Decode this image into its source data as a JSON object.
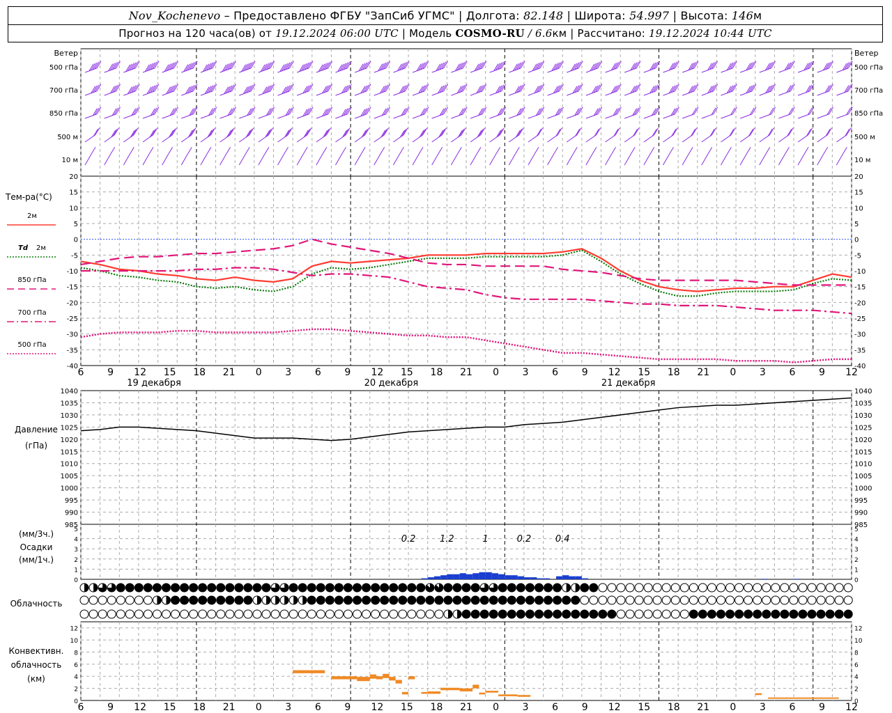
{
  "header": {
    "station": "Nov_Kochenevo",
    "provider": "– Предоставлено ФГБУ \"ЗапСиб УГМС\"",
    "lon_label": "Долгота:",
    "lon_value": "82.148",
    "lat_label": "Широта:",
    "lat_value": "54.997",
    "alt_label": "Высота:",
    "alt_value": "146",
    "alt_unit": "м",
    "forecast_prefix": "Прогноз на 120 часа(ов) от",
    "forecast_start": "19.12.2024 06:00 UTC",
    "model_label": "Модель",
    "model_name": "COSMO-RU",
    "model_res": "/ 6.6",
    "model_res_unit": "км",
    "calc_label": "Рассчитано:",
    "calc_time": "19.12.2024 10:44 UTC"
  },
  "time_axis": {
    "hour_ticks": [
      "6",
      "9",
      "12",
      "15",
      "18",
      "21",
      "0",
      "3",
      "6",
      "9",
      "12",
      "15",
      "18",
      "21",
      "0",
      "3",
      "6",
      "9",
      "12",
      "15",
      "18",
      "21",
      "0",
      "3",
      "6",
      "9",
      "12"
    ],
    "day_labels": [
      "19 декабря",
      "20 декабря",
      "21 декабря"
    ]
  },
  "wind_panel": {
    "title": "Ветер",
    "levels": [
      "500 гПа",
      "700 гПа",
      "850 гПа",
      "500 м",
      "10 м"
    ],
    "color": "#8a2be2"
  },
  "temp_panel": {
    "title": "Тем-ра(°C)",
    "legend": [
      {
        "label": "2м",
        "color": "#ff3b30",
        "style": "solid"
      },
      {
        "label_italic": "Td",
        "label": "2м",
        "color": "#0a7a0a",
        "style": "dotted"
      },
      {
        "label": "850 гПа",
        "color": "#e0157a",
        "style": "dash"
      },
      {
        "label": "700 гПа",
        "color": "#e0157a",
        "style": "dashdot"
      },
      {
        "label": "500 гПа",
        "color": "#e0157a",
        "style": "dotted"
      }
    ],
    "y_ticks": [
      "20",
      "15",
      "10",
      "5",
      "0",
      "-5",
      "-10",
      "-15",
      "-20",
      "-25",
      "-30",
      "-35",
      "-40"
    ]
  },
  "pressure_panel": {
    "title": "Давление",
    "unit": "(гПа)",
    "y_ticks": [
      "1040",
      "1035",
      "1030",
      "1025",
      "1020",
      "1015",
      "1010",
      "1005",
      "1000",
      "995",
      "990",
      "985"
    ]
  },
  "precip_panel": {
    "unit3": "(мм/3ч.)",
    "title": "Осадки",
    "unit1": "(мм/1ч.)",
    "y_ticks": [
      "5",
      "4",
      "3",
      "2",
      "1",
      "0"
    ],
    "totals": [
      "0.2",
      "1.2",
      "1",
      "0.2",
      "0.4"
    ]
  },
  "cloud_panel": {
    "title": "Облачность"
  },
  "conv_panel": {
    "title1": "Конвективн.",
    "title2": "облачность",
    "unit": "(км)",
    "y_ticks": [
      "12",
      "10",
      "8",
      "6",
      "4",
      "2",
      "0"
    ],
    "color": "#f08a24"
  },
  "chart_data": [
    {
      "type": "line",
      "name": "temperature",
      "x_hours": [
        0,
        3,
        6,
        9,
        12,
        15,
        18,
        21,
        24,
        27,
        30,
        33,
        36,
        39,
        42,
        45,
        48,
        51,
        54,
        57,
        60,
        63,
        66,
        69,
        72,
        75,
        78,
        81,
        84,
        87,
        90,
        93,
        96,
        99,
        102,
        105,
        108,
        111,
        114,
        117,
        120
      ],
      "ylim": [
        -40,
        20
      ],
      "series": [
        {
          "name": "2м",
          "values": [
            -7,
            -8,
            -9.5,
            -10,
            -11,
            -11.5,
            -12.5,
            -13,
            -12,
            -13,
            -13.5,
            -12.5,
            -8.5,
            -7,
            -7.5,
            -7,
            -6.5,
            -6,
            -5,
            -5,
            -5,
            -4.5,
            -4.5,
            -4.5,
            -4.5,
            -4,
            -3,
            -6,
            -10,
            -13,
            -15,
            -16,
            -16.5,
            -16,
            -15.5,
            -15.5,
            -15,
            -15,
            -13,
            -11,
            -12
          ]
        },
        {
          "name": "Td 2м",
          "values": [
            -9,
            -10,
            -11.5,
            -12,
            -13,
            -13.5,
            -15,
            -15.5,
            -15,
            -16,
            -16.5,
            -15,
            -11,
            -9,
            -9.5,
            -9,
            -8,
            -7,
            -6,
            -6,
            -6,
            -5.5,
            -5.5,
            -5.5,
            -5.5,
            -5,
            -3.5,
            -7,
            -11,
            -14,
            -16.5,
            -18,
            -18,
            -17,
            -16.5,
            -16.5,
            -16.5,
            -16,
            -14,
            -12.5,
            -13
          ]
        },
        {
          "name": "850 гПа",
          "values": [
            -8,
            -7,
            -6,
            -5.5,
            -5.5,
            -5,
            -4.5,
            -4.5,
            -4,
            -3.5,
            -3,
            -2,
            0,
            -1.5,
            -2.5,
            -3.5,
            -4.5,
            -6,
            -7.5,
            -8,
            -8,
            -8.5,
            -8.5,
            -8.5,
            -8.5,
            -9.5,
            -10,
            -10.5,
            -11.5,
            -12.5,
            -13,
            -13,
            -13,
            -13,
            -13,
            -13.5,
            -14,
            -14.5,
            -14.5,
            -14.5,
            -14.5
          ]
        },
        {
          "name": "700 гПа",
          "values": [
            -10,
            -10,
            -10,
            -10,
            -10,
            -10,
            -9.5,
            -9.5,
            -9,
            -9,
            -9.5,
            -10.5,
            -11.5,
            -11,
            -11,
            -11.5,
            -12,
            -13.5,
            -15,
            -15.5,
            -16,
            -17.5,
            -18.5,
            -19,
            -19,
            -19,
            -19,
            -19.5,
            -20,
            -20.5,
            -20.5,
            -21,
            -21,
            -21,
            -21.5,
            -22,
            -22.5,
            -22.5,
            -22.5,
            -23,
            -23.5
          ]
        },
        {
          "name": "500 гПа",
          "values": [
            -31,
            -30,
            -29.5,
            -29.5,
            -29.5,
            -29,
            -29,
            -29.5,
            -29.5,
            -29.5,
            -29.5,
            -29,
            -28.5,
            -28.5,
            -29,
            -29.5,
            -30,
            -30.5,
            -30.5,
            -31,
            -31,
            -32,
            -33,
            -34,
            -35,
            -36,
            -36,
            -36.5,
            -37,
            -37.5,
            -38,
            -38,
            -38,
            -38,
            -38.5,
            -38.5,
            -38.5,
            -39,
            -38.5,
            -38,
            -38
          ]
        }
      ]
    },
    {
      "type": "line",
      "name": "pressure",
      "x_hours": [
        0,
        3,
        6,
        9,
        12,
        15,
        18,
        21,
        24,
        27,
        30,
        33,
        36,
        39,
        42,
        45,
        48,
        51,
        54,
        57,
        60,
        63,
        66,
        69,
        72,
        75,
        78,
        81,
        84,
        87,
        90,
        93,
        96,
        99,
        102,
        105,
        108,
        111,
        114,
        117,
        120
      ],
      "ylim": [
        985,
        1040
      ],
      "series": [
        {
          "name": "Давление",
          "values": [
            1023.5,
            1024,
            1025,
            1025,
            1024.5,
            1024,
            1023.5,
            1022.5,
            1021.5,
            1020.5,
            1020.5,
            1020.5,
            1020,
            1019.5,
            1020,
            1021,
            1022,
            1023,
            1023.5,
            1024,
            1024.5,
            1025,
            1025,
            1026,
            1026.5,
            1027,
            1028,
            1029,
            1030,
            1031,
            1032,
            1033,
            1033.5,
            1034,
            1034,
            1034.5,
            1035,
            1035.5,
            1036,
            1036.5,
            1037
          ]
        }
      ]
    },
    {
      "type": "bar",
      "name": "precipitation_mm_per_h",
      "x_hours": [
        51,
        52,
        53,
        54,
        55,
        56,
        57,
        58,
        59,
        60,
        61,
        62,
        63,
        64,
        65,
        66,
        67,
        68,
        69,
        70,
        71,
        72,
        73,
        74,
        75,
        76,
        77,
        78,
        79,
        80,
        81,
        82,
        83,
        84,
        85,
        86,
        87,
        88,
        89,
        90,
        91,
        92,
        93,
        94,
        95,
        96,
        97,
        98,
        99,
        100,
        101,
        102,
        103,
        104,
        105,
        106,
        107,
        108,
        109,
        110,
        111,
        112,
        113,
        114,
        115,
        116,
        117,
        118,
        119,
        120
      ],
      "values": [
        0,
        0,
        0.1,
        0.2,
        0.3,
        0.4,
        0.5,
        0.5,
        0.6,
        0.5,
        0.6,
        0.7,
        0.7,
        0.6,
        0.5,
        0.4,
        0.4,
        0.3,
        0.2,
        0.2,
        0.1,
        0.1,
        0,
        0.3,
        0.4,
        0.3,
        0.3,
        0.1,
        0,
        0,
        0,
        0,
        0,
        0,
        0,
        0,
        0,
        0,
        0,
        0,
        0,
        0,
        0,
        0,
        0,
        0,
        0,
        0,
        0,
        0,
        0,
        0,
        0,
        0,
        0,
        0.05,
        0,
        0,
        0,
        0,
        0.05,
        0,
        0,
        0,
        0,
        0,
        0,
        0,
        0,
        0
      ],
      "ylim": [
        0,
        5
      ]
    },
    {
      "type": "table",
      "name": "cloudiness_oktas",
      "rows": [
        "low",
        "mid",
        "high"
      ],
      "x_hours": [
        0,
        3,
        6,
        9,
        12,
        15,
        18,
        21,
        24,
        27,
        30,
        33,
        36,
        39,
        42,
        45,
        48,
        51,
        54,
        57,
        60,
        63,
        66,
        69,
        72,
        75,
        78,
        81,
        84,
        87,
        90,
        93,
        96,
        99,
        102,
        105,
        108,
        111,
        114,
        117,
        120
      ],
      "note_scale": "0=clear circle, 4=half, 8=filled",
      "low": [
        4,
        6,
        8,
        8,
        8,
        8,
        8,
        8,
        8,
        8,
        6,
        8,
        8,
        8,
        8,
        8,
        8,
        8,
        7,
        8,
        8,
        6,
        8,
        8,
        8,
        4,
        8,
        0,
        0,
        0,
        0,
        0,
        0,
        0,
        0,
        0,
        0,
        0,
        0,
        0,
        0
      ],
      "mid": [
        0,
        0,
        0,
        0,
        4,
        8,
        8,
        8,
        8,
        4,
        4,
        4,
        8,
        8,
        8,
        8,
        8,
        8,
        8,
        8,
        8,
        8,
        8,
        8,
        8,
        8,
        0,
        0,
        0,
        0,
        0,
        0,
        0,
        0,
        0,
        0,
        0,
        0,
        0,
        0,
        0
      ],
      "high": [
        0,
        0,
        0,
        0,
        0,
        0,
        0,
        0,
        0,
        0,
        0,
        0,
        0,
        0,
        0,
        0,
        0,
        0,
        0,
        4,
        8,
        8,
        8,
        8,
        8,
        8,
        8,
        8,
        0,
        0,
        0,
        0,
        8,
        8,
        8,
        8,
        8,
        8,
        8,
        8,
        8
      ]
    },
    {
      "type": "bar",
      "name": "convective_cloud_km",
      "segments": [
        {
          "x0": 33,
          "x1": 38,
          "base": 4.5,
          "top": 5.0
        },
        {
          "x0": 39,
          "x1": 43,
          "base": 3.5,
          "top": 4.0
        },
        {
          "x0": 43,
          "x1": 45,
          "base": 3.2,
          "top": 3.9
        },
        {
          "x0": 45,
          "x1": 46,
          "base": 3.6,
          "top": 4.3
        },
        {
          "x0": 46,
          "x1": 47,
          "base": 3.5,
          "top": 4.0
        },
        {
          "x0": 47,
          "x1": 48,
          "base": 3.7,
          "top": 4.4
        },
        {
          "x0": 48,
          "x1": 49,
          "base": 3.3,
          "top": 3.9
        },
        {
          "x0": 49,
          "x1": 50,
          "base": 2.8,
          "top": 3.4
        },
        {
          "x0": 50,
          "x1": 51,
          "base": 1.0,
          "top": 1.4
        },
        {
          "x0": 51,
          "x1": 52,
          "base": 3.5,
          "top": 4.0
        },
        {
          "x0": 53,
          "x1": 54,
          "base": 1.1,
          "top": 1.4
        },
        {
          "x0": 54,
          "x1": 56,
          "base": 1.1,
          "top": 1.5
        },
        {
          "x0": 56,
          "x1": 59,
          "base": 1.7,
          "top": 2.1
        },
        {
          "x0": 59,
          "x1": 61,
          "base": 1.5,
          "top": 2.0
        },
        {
          "x0": 61,
          "x1": 62,
          "base": 2.0,
          "top": 2.6
        },
        {
          "x0": 62,
          "x1": 63,
          "base": 1.0,
          "top": 1.3
        },
        {
          "x0": 63,
          "x1": 65,
          "base": 1.3,
          "top": 1.6
        },
        {
          "x0": 65,
          "x1": 68,
          "base": 0.7,
          "top": 1.0
        },
        {
          "x0": 68,
          "x1": 70,
          "base": 0.6,
          "top": 0.9
        },
        {
          "x0": 105,
          "x1": 106,
          "base": 0.9,
          "top": 1.2
        },
        {
          "x0": 107,
          "x1": 118,
          "base": 0.3,
          "top": 0.5
        }
      ],
      "ylim": [
        0,
        13
      ]
    },
    {
      "type": "scatter",
      "name": "wind_barbs",
      "levels": [
        "500 гПа",
        "700 гПа",
        "850 гПа",
        "500 м",
        "10 м"
      ],
      "x_hours": [
        0,
        3,
        6,
        9,
        12,
        15,
        18,
        21,
        24,
        27,
        30,
        33,
        36,
        39,
        42,
        45,
        48,
        51,
        54,
        57,
        60,
        63,
        66,
        69,
        72,
        75,
        78,
        81,
        84,
        87,
        90,
        93,
        96,
        99,
        102,
        105,
        108,
        111,
        114,
        117,
        120
      ],
      "speed_knots": {
        "500 гПа": [
          45,
          50,
          60,
          60,
          65,
          65,
          65,
          65,
          65,
          60,
          60,
          60,
          55,
          55,
          50,
          50,
          50,
          50,
          50,
          50,
          50,
          50,
          50,
          45,
          45,
          45,
          45,
          40,
          40,
          40,
          40,
          40,
          40,
          40,
          40,
          40,
          40,
          40,
          35,
          35,
          35
        ],
        "700 гПа": [
          35,
          40,
          45,
          45,
          45,
          45,
          45,
          45,
          45,
          45,
          45,
          40,
          40,
          40,
          40,
          40,
          40,
          40,
          40,
          40,
          40,
          40,
          40,
          40,
          40,
          40,
          40,
          35,
          35,
          35,
          35,
          35,
          35,
          35,
          35,
          35,
          30,
          30,
          30,
          30,
          30
        ],
        "850 гПа": [
          25,
          30,
          30,
          30,
          30,
          30,
          30,
          30,
          30,
          30,
          30,
          35,
          35,
          35,
          35,
          30,
          30,
          30,
          25,
          25,
          25,
          25,
          25,
          25,
          25,
          25,
          25,
          25,
          25,
          25,
          25,
          20,
          20,
          20,
          20,
          20,
          20,
          20,
          20,
          20,
          20
        ],
        "500 м": [
          20,
          25,
          25,
          25,
          25,
          25,
          25,
          25,
          25,
          25,
          25,
          30,
          30,
          30,
          30,
          30,
          25,
          25,
          25,
          25,
          25,
          25,
          25,
          20,
          20,
          20,
          20,
          20,
          20,
          20,
          20,
          15,
          15,
          15,
          15,
          15,
          15,
          15,
          15,
          15,
          15
        ],
        "10 м": [
          10,
          10,
          10,
          10,
          10,
          10,
          10,
          10,
          10,
          10,
          10,
          10,
          10,
          10,
          10,
          10,
          10,
          10,
          10,
          10,
          10,
          10,
          10,
          10,
          10,
          10,
          10,
          10,
          10,
          10,
          10,
          10,
          10,
          10,
          10,
          10,
          10,
          10,
          10,
          10,
          10
        ]
      }
    }
  ]
}
